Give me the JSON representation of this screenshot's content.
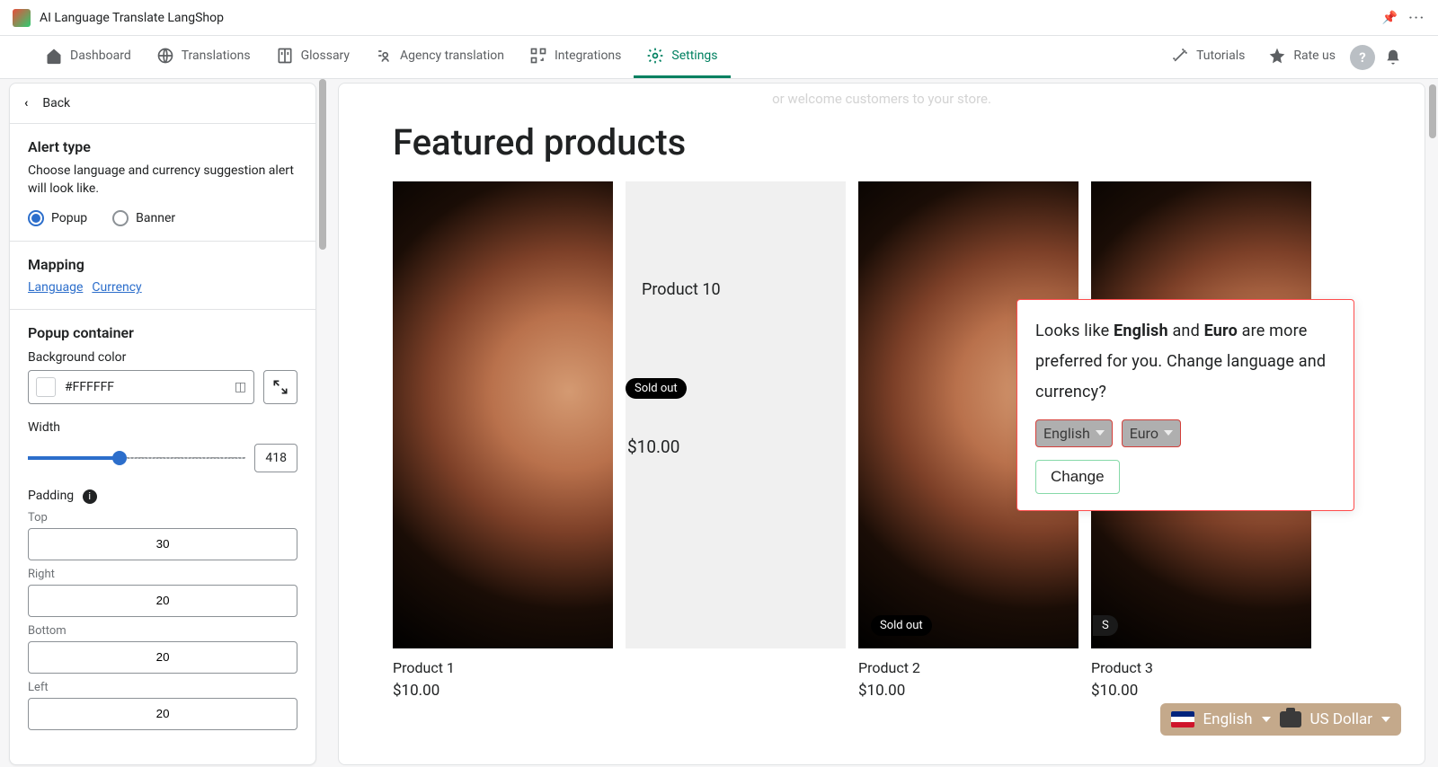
{
  "header": {
    "app_title": "AI Language Translate LangShop"
  },
  "nav": {
    "dashboard": "Dashboard",
    "translations": "Translations",
    "glossary": "Glossary",
    "agency": "Agency translation",
    "integrations": "Integrations",
    "settings": "Settings",
    "tutorials": "Tutorials",
    "rate": "Rate us"
  },
  "sidebar": {
    "back": "Back",
    "alert_type_h": "Alert type",
    "alert_type_desc": "Choose language and currency suggestion alert will look like.",
    "radio_popup": "Popup",
    "radio_banner": "Banner",
    "mapping_h": "Mapping",
    "link_language": "Language",
    "link_currency": "Currency",
    "popup_container_h": "Popup container",
    "bgcolor_label": "Background color",
    "bgcolor_value": "#FFFFFF",
    "width_label": "Width",
    "width_value": "418",
    "padding_label": "Padding",
    "pad_top_label": "Top",
    "pad_top": "30",
    "pad_right_label": "Right",
    "pad_right": "20",
    "pad_bottom_label": "Bottom",
    "pad_bottom": "20",
    "pad_left_label": "Left",
    "pad_left": "20"
  },
  "preview": {
    "faded_line": "or welcome customers to your store.",
    "featured_h": "Featured products",
    "products": [
      {
        "name": "Product 1",
        "price": "$10.00",
        "sold_out": false
      },
      {
        "name": "Product 10",
        "price": "$10.00",
        "sold_out": true,
        "badge": "Sold out"
      },
      {
        "name": "Product 2",
        "price": "$10.00",
        "sold_out": true,
        "badge": "Sold out"
      },
      {
        "name": "Product 3",
        "price": "$10.00",
        "sold_out": true,
        "badge": "S"
      }
    ],
    "popup": {
      "msg_prefix": "Looks like ",
      "msg_lang": "English",
      "msg_mid": " and ",
      "msg_curr": "Euro",
      "msg_suffix": " are more preferred for you. Change language and currency?",
      "sel_lang": "English",
      "sel_curr": "Euro",
      "change_btn": "Change"
    },
    "switcher": {
      "lang": "English",
      "curr": "US Dollar"
    }
  }
}
